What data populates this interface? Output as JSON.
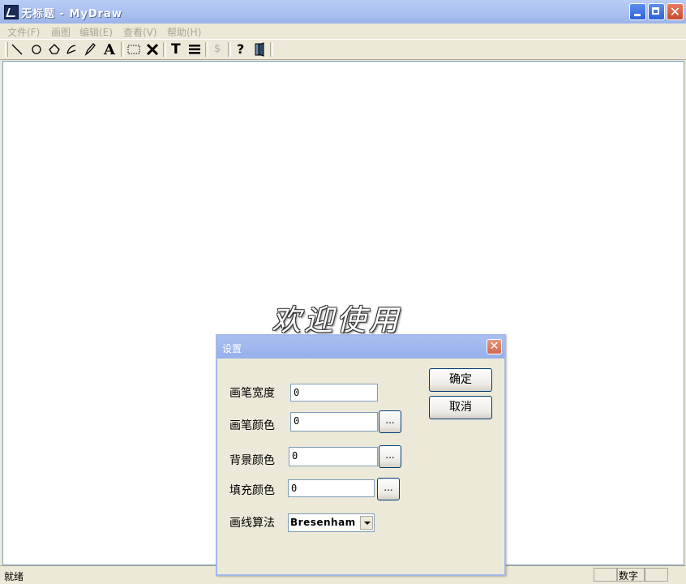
{
  "window": {
    "title": "无标题 - MyDraw",
    "controls": {
      "close_glyph": "✕"
    }
  },
  "menu": [
    "文件(F)",
    "画图",
    "编辑(E)",
    "查看(V)",
    "帮助(H)"
  ],
  "toolbar": {
    "tools": [
      {
        "name": "line-tool",
        "icon": "line-icon"
      },
      {
        "name": "ellipse-tool",
        "icon": "ellipse-icon"
      },
      {
        "name": "polygon-tool",
        "icon": "polygon-icon"
      },
      {
        "name": "curve-tool",
        "icon": "curve-icon"
      },
      {
        "name": "pencil-tool",
        "icon": "pencil-icon"
      },
      {
        "name": "text-tool",
        "icon": "text-a-icon"
      },
      {
        "name": "select-tool",
        "icon": "dotted-rect-icon"
      },
      {
        "name": "delete-tool",
        "icon": "x-icon"
      },
      {
        "name": "text-format-tool",
        "icon": "t-icon"
      },
      {
        "name": "line-width-tool",
        "icon": "line-weight-icon"
      },
      {
        "name": "disabled-tool",
        "icon": "dollar-icon"
      },
      {
        "name": "help-tool",
        "icon": "help-icon"
      },
      {
        "name": "exit-tool",
        "icon": "door-icon"
      }
    ],
    "text_glyph": "A",
    "t_glyph": "T",
    "dollar_glyph": "$",
    "help_glyph": "?"
  },
  "canvas": {
    "welcome_text": "欢迎使用"
  },
  "statusbar": {
    "text": "就绪",
    "num_indicator": "数字"
  },
  "dialog": {
    "title": "设置",
    "close_glyph": "✕",
    "ok_label": "确定",
    "cancel_label": "取消",
    "fields": [
      {
        "label": "画笔宽度",
        "value": "0"
      },
      {
        "label": "画笔颜色",
        "value": "0",
        "button": "..."
      },
      {
        "label": "背景颜色",
        "value": "0",
        "button": "..."
      },
      {
        "label": "填充颜色",
        "value": "0",
        "button": "..."
      }
    ],
    "algorithm": {
      "label": "画线算法",
      "value": "Bresenham"
    }
  }
}
